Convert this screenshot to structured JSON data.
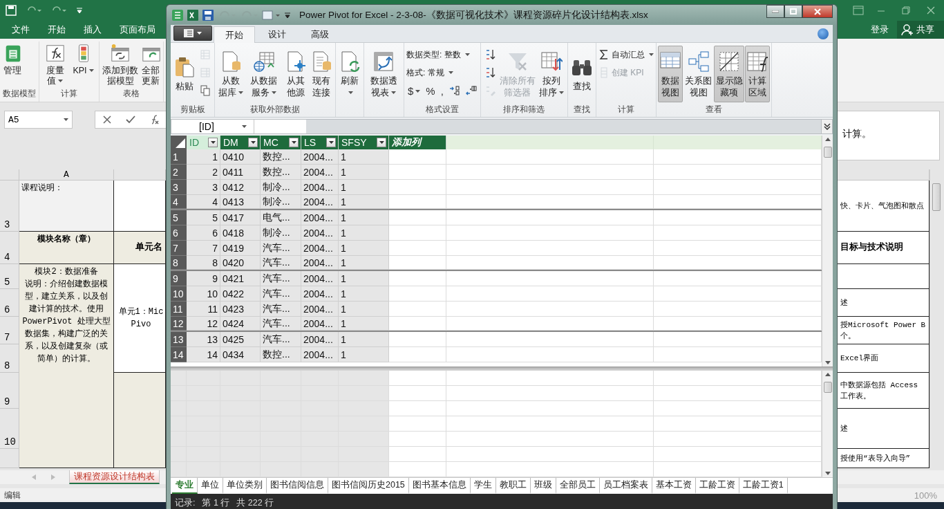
{
  "excel": {
    "tabs": [
      {
        "label": "文件"
      },
      {
        "label": "开始"
      },
      {
        "label": "插入"
      },
      {
        "label": "页面布局"
      }
    ],
    "account": {
      "sign_in": "登录",
      "share": "共享"
    },
    "ribbon_groups": [
      {
        "label": "数据模型",
        "buttons": [
          {
            "label": "管理",
            "dropdown": false
          }
        ]
      },
      {
        "label": "计算",
        "buttons": [
          {
            "label": "度量值",
            "dropdown": true
          },
          {
            "label": "KPI",
            "dropdown": true
          }
        ]
      },
      {
        "label": "表格",
        "buttons": [
          {
            "label": "添加到数据模型",
            "dropdown": false
          },
          {
            "label": "全部更新",
            "dropdown": false
          }
        ]
      }
    ],
    "name_box": "A5",
    "formula_text": "计算。",
    "column_header": "A",
    "row_numbers": [
      "3",
      "4",
      "5",
      "6",
      "7",
      "8",
      "9",
      "10"
    ],
    "note_cell": "课程说明：",
    "headings": [
      "模块名称（章）",
      "单元名"
    ],
    "module_title": "模块2：数据准备",
    "module_description": "说明：介绍创建数据模型，建立关系，以及创建计算的技术。使用PowerPivot 处理大型数据集，构建广泛的关系，以及创建复杂（或简单）的计算。",
    "unit_cell": [
      "单元1：Mic",
      "Pivo"
    ],
    "right_cells": [
      {
        "kind": "text",
        "lines": [
          "快、卡片、气泡图和散点"
        ],
        "bold": false
      },
      {
        "kind": "text",
        "lines": [
          "目标与技术说明"
        ],
        "bold": true
      },
      {
        "kind": "empty"
      },
      {
        "kind": "text",
        "lines": [
          "述"
        ],
        "bold": false
      },
      {
        "kind": "text",
        "lines": [
          "授Microsoft Power B",
          "个。"
        ],
        "bold": false
      },
      {
        "kind": "text",
        "lines": [
          "Excel界面"
        ],
        "bold": false
      },
      {
        "kind": "text",
        "lines": [
          "中数据源包括 Access",
          "工作表。"
        ],
        "bold": false
      },
      {
        "kind": "text",
        "lines": [
          "述"
        ],
        "bold": false
      },
      {
        "kind": "text",
        "lines": [
          "授使用“表导入向导”"
        ],
        "bold": false
      }
    ],
    "sheet_tabs": [
      {
        "label": "课程资源设计结构表",
        "selected": true
      }
    ],
    "status": "编辑",
    "zoom": "100%"
  },
  "power_pivot": {
    "title": "Power Pivot for Excel - 2-3-08-《数据可视化技术》课程资源碎片化设计结构表.xlsx",
    "tabs": [
      {
        "label": "开始",
        "selected": true
      },
      {
        "label": "设计",
        "selected": false
      },
      {
        "label": "高级",
        "selected": false
      }
    ],
    "ribbon_groups": [
      {
        "label": "剪贴板",
        "columns": [
          [
            {
              "kind": "large",
              "label": "粘贴",
              "dropdown": false,
              "disabled": false
            }
          ],
          [
            {
              "kind": "icon",
              "disabled": true
            },
            {
              "kind": "icon",
              "disabled": true
            },
            {
              "kind": "icon",
              "disabled": false
            }
          ]
        ]
      },
      {
        "label": "获取外部数据",
        "columns": [
          [
            {
              "kind": "large",
              "label": "从数据库",
              "dropdown": true
            }
          ],
          [
            {
              "kind": "large",
              "label": "从数据服务",
              "dropdown": true
            }
          ],
          [
            {
              "kind": "large",
              "label": "从其他源",
              "dropdown": false
            }
          ],
          [
            {
              "kind": "large",
              "label": "现有连接",
              "dropdown": false
            }
          ]
        ]
      },
      {
        "columns": [
          [
            {
              "kind": "large",
              "label": "刷新",
              "dropdown": true
            }
          ]
        ]
      },
      {
        "columns": [
          [
            {
              "kind": "large",
              "label": "数据透视表",
              "dropdown": true
            }
          ]
        ]
      },
      {
        "label": "格式设置",
        "columns": [
          [
            {
              "kind": "small",
              "label": "数据类型: 整数",
              "dropdown": true
            },
            {
              "kind": "small",
              "label": "格式: 常规",
              "dropdown": true
            },
            {
              "kind": "row",
              "items": [
                {
                  "kind": "symbol",
                  "label": "$",
                  "dropdown": true
                },
                {
                  "kind": "symbol",
                  "label": "%",
                  "dropdown": false
                },
                {
                  "kind": "symbol",
                  "label": ",",
                  "dropdown": false
                },
                {
                  "kind": "icon",
                  "disabled": false
                },
                {
                  "kind": "icon",
                  "disabled": false
                }
              ]
            }
          ]
        ]
      },
      {
        "label": "排序和筛选",
        "columns": [
          [
            {
              "kind": "icon",
              "disabled": false
            },
            {
              "kind": "icon",
              "disabled": false
            },
            {
              "kind": "icon",
              "disabled": true
            }
          ],
          [
            {
              "kind": "large",
              "label": "清除所有筛选器",
              "dropdown": false,
              "disabled": true
            }
          ],
          [
            {
              "kind": "large",
              "label": "按列排序",
              "dropdown": true,
              "disabled": false
            }
          ]
        ]
      },
      {
        "label": "查找",
        "columns": [
          [
            {
              "kind": "large",
              "label": "查找",
              "dropdown": false
            }
          ]
        ]
      },
      {
        "label": "计算",
        "columns": [
          [
            {
              "kind": "small",
              "label": "自动汇总",
              "dropdown": true,
              "disabled": false
            },
            {
              "kind": "small",
              "label": "创建 KPI",
              "dropdown": false,
              "disabled": true
            }
          ]
        ]
      },
      {
        "label": "查看",
        "columns": [
          [
            {
              "kind": "large",
              "label": "数据视图",
              "selected": true
            }
          ],
          [
            {
              "kind": "large",
              "label": "关系图视图",
              "selected": false
            }
          ],
          [
            {
              "kind": "large",
              "label": "显示隐藏项",
              "selected": true
            }
          ],
          [
            {
              "kind": "large",
              "label": "计算区域",
              "selected": true
            }
          ]
        ]
      }
    ],
    "name_box": "[ID]",
    "columns": [
      {
        "name": "ID",
        "kind": "data",
        "selected": true
      },
      {
        "name": "DM",
        "kind": "data",
        "selected": false
      },
      {
        "name": "MC",
        "kind": "data",
        "selected": false
      },
      {
        "name": "LS",
        "kind": "data",
        "selected": false
      },
      {
        "name": "SFSY",
        "kind": "data",
        "selected": false
      },
      {
        "name": "添加列",
        "kind": "add",
        "selected": false
      }
    ],
    "rows": [
      {
        "number": "1",
        "cells": [
          "1",
          "0410",
          "数控...",
          "2004...",
          "1"
        ]
      },
      {
        "number": "2",
        "cells": [
          "2",
          "0411",
          "数控...",
          "2004...",
          "1"
        ]
      },
      {
        "number": "3",
        "cells": [
          "3",
          "0412",
          "制冷...",
          "2004...",
          "1"
        ]
      },
      {
        "number": "4",
        "cells": [
          "4",
          "0413",
          "制冷...",
          "2004...",
          "1"
        ]
      },
      {
        "number": "5",
        "cells": [
          "5",
          "0417",
          "电气...",
          "2004...",
          "1"
        ]
      },
      {
        "number": "6",
        "cells": [
          "6",
          "0418",
          "制冷...",
          "2004...",
          "1"
        ]
      },
      {
        "number": "7",
        "cells": [
          "7",
          "0419",
          "汽车...",
          "2004...",
          "1"
        ]
      },
      {
        "number": "8",
        "cells": [
          "8",
          "0420",
          "汽车...",
          "2004...",
          "1"
        ]
      },
      {
        "number": "9",
        "cells": [
          "9",
          "0421",
          "汽车...",
          "2004...",
          "1"
        ]
      },
      {
        "number": "10",
        "cells": [
          "10",
          "0422",
          "汽车...",
          "2004...",
          "1"
        ]
      },
      {
        "number": "11",
        "cells": [
          "11",
          "0423",
          "汽车...",
          "2004...",
          "1"
        ]
      },
      {
        "number": "12",
        "cells": [
          "12",
          "0424",
          "汽车...",
          "2004...",
          "1"
        ]
      },
      {
        "number": "13",
        "cells": [
          "13",
          "0425",
          "汽车...",
          "2004...",
          "1"
        ]
      },
      {
        "number": "14",
        "cells": [
          "14",
          "0434",
          "数控...",
          "2004...",
          "1"
        ]
      }
    ],
    "table_tabs": [
      {
        "label": "专业",
        "selected": true
      },
      {
        "label": "单位",
        "selected": false
      },
      {
        "label": "单位类别",
        "selected": false
      },
      {
        "label": "图书信阅信息",
        "selected": false
      },
      {
        "label": "图书信阅历史2015",
        "selected": false
      },
      {
        "label": "图书基本信息",
        "selected": false
      },
      {
        "label": "学生",
        "selected": false
      },
      {
        "label": "教职工",
        "selected": false
      },
      {
        "label": "班级",
        "selected": false
      },
      {
        "label": "全部员工",
        "selected": false
      },
      {
        "label": "员工档案表",
        "selected": false
      },
      {
        "label": "基本工资",
        "selected": false
      },
      {
        "label": "工龄工资",
        "selected": false
      },
      {
        "label": "工龄工资1",
        "selected": false
      }
    ],
    "status": {
      "label": "记录:",
      "position": "第 1 行",
      "total": "共 222 行"
    }
  }
}
